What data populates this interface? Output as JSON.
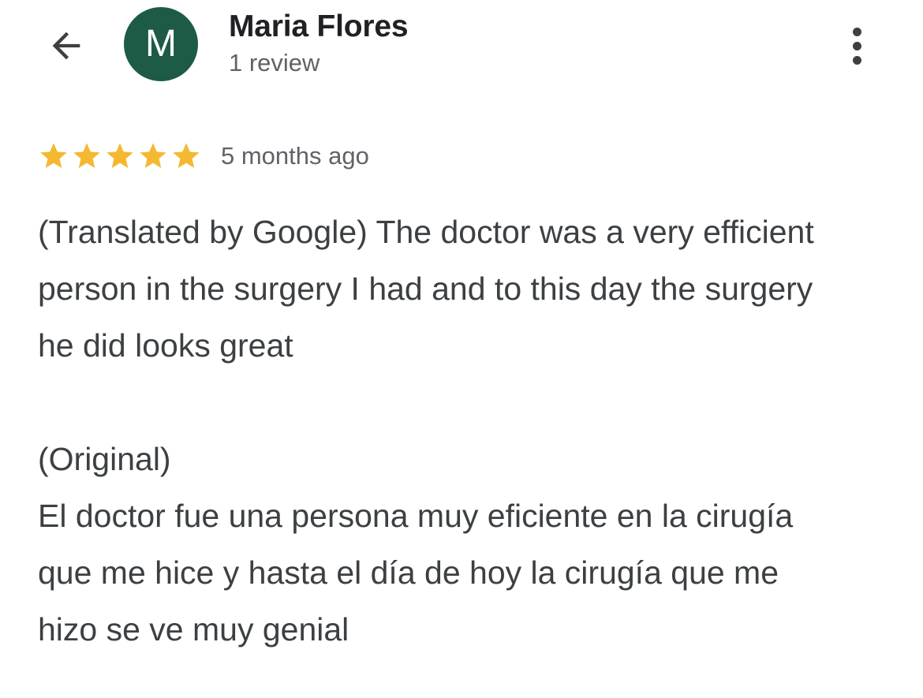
{
  "header": {
    "back_icon": "arrow-back-icon",
    "avatar_letter": "M",
    "avatar_color": "#1d5b47",
    "user_name": "Maria Flores",
    "review_count": "1 review",
    "menu_icon": "more-vert-icon"
  },
  "review": {
    "rating": 5,
    "rating_max": 5,
    "star_color": "#f4b930",
    "date": "5 months ago",
    "translated_text": "(Translated by Google) The doctor was a very efficient person in the surgery I had and to this day the surgery he did looks great",
    "original_label": "(Original)",
    "original_text": "El doctor fue una persona muy eficiente en la cirugía que me hice y hasta el día de hoy la cirugía que me hizo se ve muy genial"
  }
}
